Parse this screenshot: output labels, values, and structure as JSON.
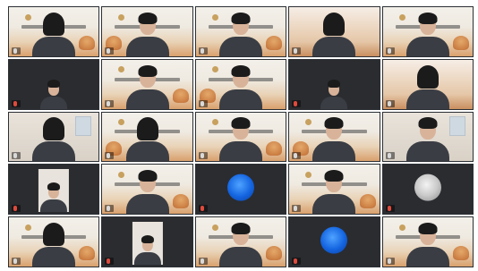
{
  "meeting": {
    "view": "gallery",
    "columns": 5,
    "rows": 5,
    "participants": [
      {
        "name": "",
        "muted": false,
        "bg": "banner",
        "avatar": "person-long-hair"
      },
      {
        "name": "",
        "muted": false,
        "bg": "banner",
        "avatar": "person"
      },
      {
        "name": "",
        "muted": false,
        "bg": "banner",
        "avatar": "person"
      },
      {
        "name": "",
        "muted": false,
        "bg": "warm",
        "avatar": "person-long-hair"
      },
      {
        "name": "",
        "muted": false,
        "bg": "banner",
        "avatar": "person"
      },
      {
        "name": "",
        "muted": true,
        "bg": "dark",
        "avatar": "person-small"
      },
      {
        "name": "",
        "muted": false,
        "bg": "banner",
        "avatar": "person"
      },
      {
        "name": "",
        "muted": false,
        "bg": "banner",
        "avatar": "person"
      },
      {
        "name": "",
        "muted": true,
        "bg": "dark",
        "avatar": "person-small"
      },
      {
        "name": "",
        "muted": false,
        "bg": "warm",
        "avatar": "person-long-hair"
      },
      {
        "name": "",
        "muted": false,
        "bg": "wall",
        "avatar": "person-long-hair"
      },
      {
        "name": "",
        "muted": false,
        "bg": "banner",
        "avatar": "person-long-hair"
      },
      {
        "name": "",
        "muted": false,
        "bg": "banner",
        "avatar": "person"
      },
      {
        "name": "",
        "muted": false,
        "bg": "banner",
        "avatar": "person"
      },
      {
        "name": "",
        "muted": false,
        "bg": "wall",
        "avatar": "person"
      },
      {
        "name": "",
        "muted": true,
        "bg": "dark",
        "avatar": "portrait"
      },
      {
        "name": "",
        "muted": false,
        "bg": "banner",
        "avatar": "person"
      },
      {
        "name": "",
        "muted": true,
        "bg": "dark",
        "avatar": "blue-circle"
      },
      {
        "name": "",
        "muted": false,
        "bg": "banner",
        "avatar": "person"
      },
      {
        "name": "",
        "muted": true,
        "bg": "dark",
        "avatar": "gray-circle"
      },
      {
        "name": "",
        "muted": false,
        "bg": "banner",
        "avatar": "person-long-hair"
      },
      {
        "name": "",
        "muted": true,
        "bg": "dark",
        "avatar": "portrait"
      },
      {
        "name": "",
        "muted": false,
        "bg": "banner",
        "avatar": "person"
      },
      {
        "name": "",
        "muted": true,
        "bg": "dark",
        "avatar": "blue-circle"
      },
      {
        "name": "",
        "muted": false,
        "bg": "banner",
        "avatar": "person"
      }
    ]
  },
  "colors": {
    "tile_bg_dark": "#2a2c30",
    "banner_orange": "#d9a06d",
    "blue_avatar": "#1464e0",
    "muted_red": "#e04a3c"
  }
}
